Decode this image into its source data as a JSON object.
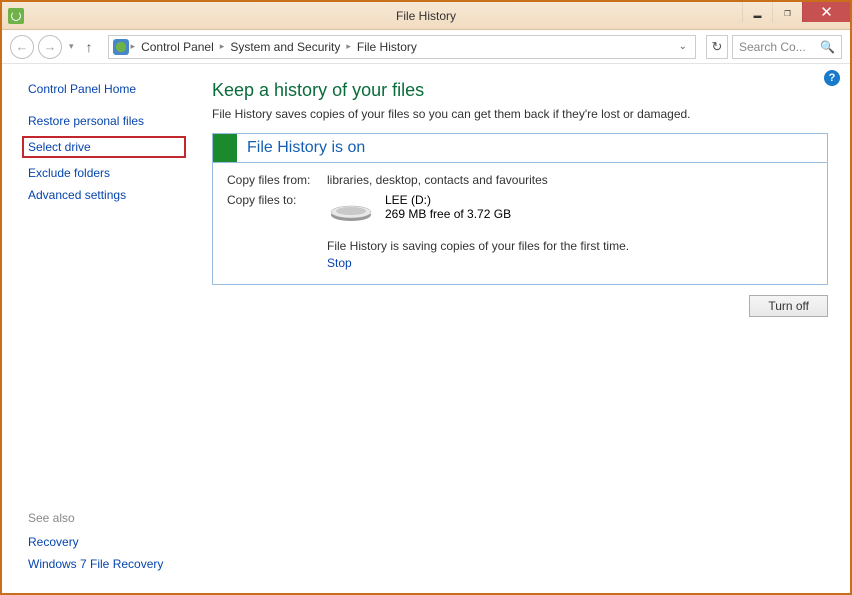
{
  "window": {
    "title": "File History"
  },
  "toolbar": {
    "breadcrumbs": [
      "Control Panel",
      "System and Security",
      "File History"
    ],
    "search_placeholder": "Search Co..."
  },
  "sidebar": {
    "home": "Control Panel Home",
    "links": [
      "Restore personal files",
      "Select drive",
      "Exclude folders",
      "Advanced settings"
    ],
    "see_also_header": "See also",
    "see_also": [
      "Recovery",
      "Windows 7 File Recovery"
    ]
  },
  "main": {
    "title": "Keep a history of your files",
    "desc": "File History saves copies of your files so you can get them back if they're lost or damaged.",
    "status": "File History is on",
    "copy_from_label": "Copy files from:",
    "copy_from_value": "libraries, desktop, contacts and favourites",
    "copy_to_label": "Copy files to:",
    "drive_name": "LEE (D:)",
    "drive_free": "269 MB free of 3.72 GB",
    "saving_msg": "File History is saving copies of your files for the first time.",
    "stop_label": "Stop",
    "turn_off_label": "Turn off"
  }
}
